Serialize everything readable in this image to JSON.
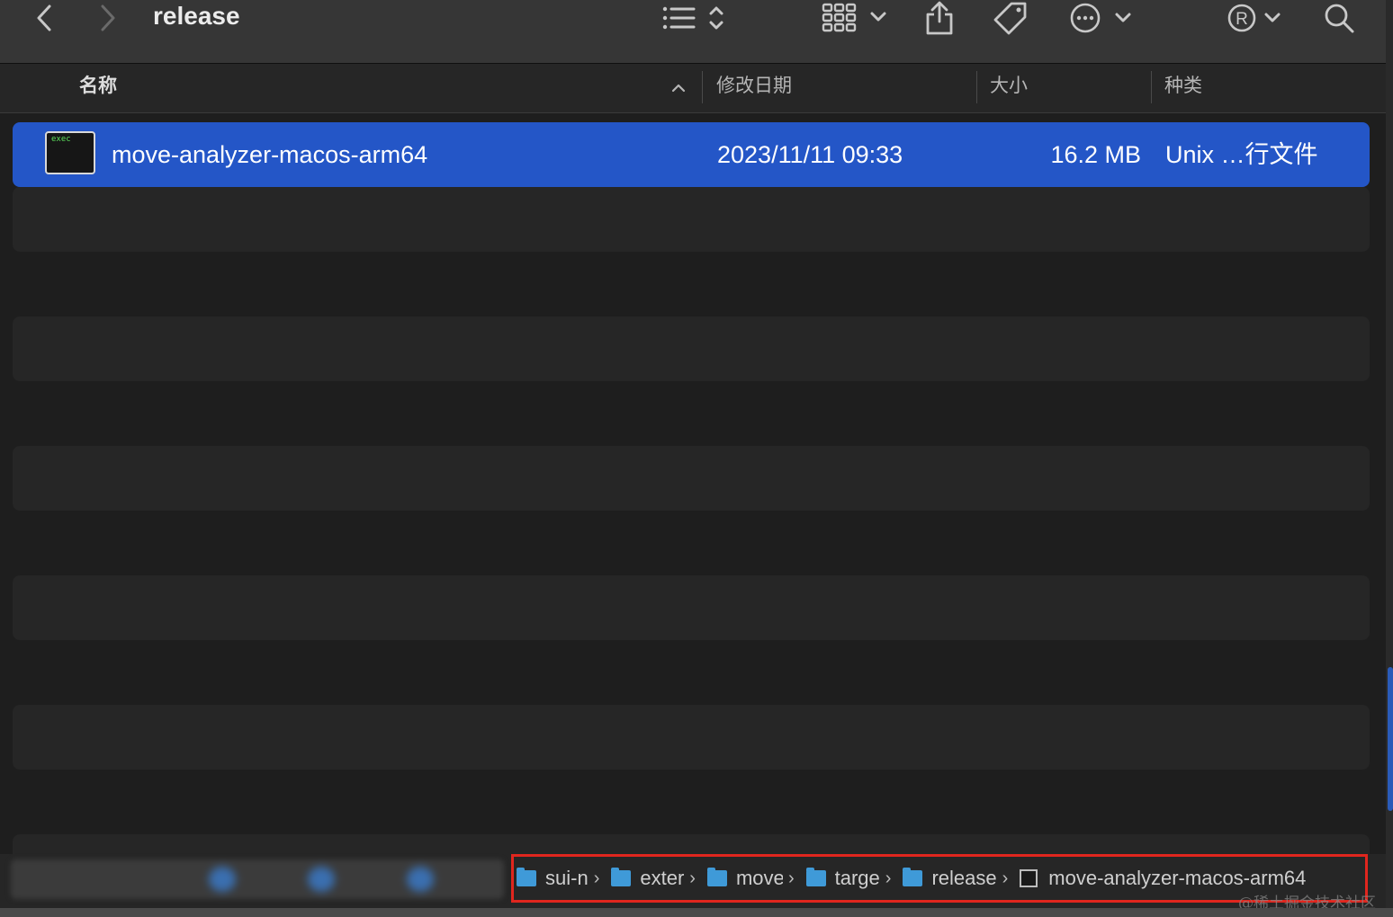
{
  "toolbar": {
    "title": "release",
    "back_icon": "chevron-left-icon",
    "forward_icon": "chevron-right-icon",
    "list_view_icon": "list-view-icon",
    "grid_view_icon": "grid-view-icon",
    "share_icon": "share-icon",
    "tag_icon": "tag-icon",
    "more_icon": "ellipsis-circle-icon",
    "r_icon": "registered-icon",
    "search_icon": "search-icon"
  },
  "columns": {
    "name": "名称",
    "date": "修改日期",
    "size": "大小",
    "kind": "种类",
    "sort_arrow": "^"
  },
  "files": [
    {
      "name": "move-analyzer-macos-arm64",
      "icon_label": "exec",
      "date": "2023/11/11 09:33",
      "size": "16.2 MB",
      "kind": "Unix …行文件",
      "selected": true
    }
  ],
  "path_bar": {
    "items": [
      {
        "label": "sui-n",
        "type": "folder"
      },
      {
        "label": "exter",
        "type": "folder"
      },
      {
        "label": "move",
        "type": "folder"
      },
      {
        "label": "targe",
        "type": "folder"
      },
      {
        "label": "release",
        "type": "folder"
      },
      {
        "label": "move-analyzer-macos-arm64",
        "type": "file"
      }
    ],
    "separator": "›"
  },
  "watermark": "@稀土掘金技术社区",
  "colors": {
    "selection": "#2456c7",
    "highlight_border": "#e0261e",
    "folder": "#3f9ad8"
  }
}
